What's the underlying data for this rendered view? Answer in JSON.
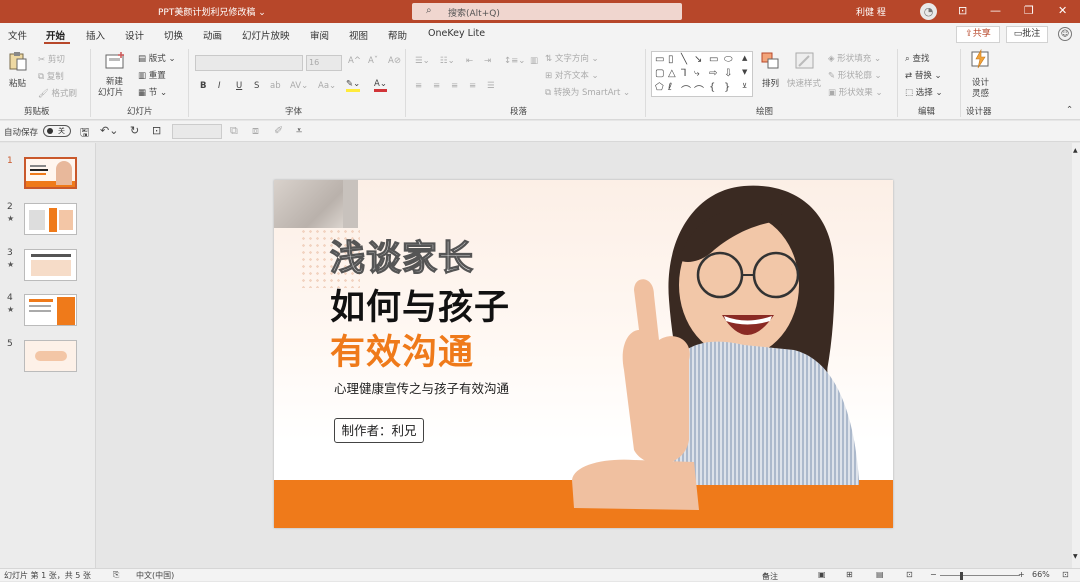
{
  "titlebar": {
    "doc_title": "PPT美颜计划利兄修改稿 ⌄",
    "search_placeholder": "搜索(Alt+Q)",
    "user": "利健 程",
    "minimize": "—",
    "restore": "❐",
    "close": "✕",
    "ribbon_options": "⊡"
  },
  "menu": {
    "tabs": [
      "文件",
      "开始",
      "插入",
      "设计",
      "切换",
      "动画",
      "幻灯片放映",
      "审阅",
      "视图",
      "帮助",
      "OneKey Lite"
    ],
    "active": "开始",
    "share": "共享",
    "comment": "批注"
  },
  "ribbon": {
    "clipboard": {
      "paste": "粘贴",
      "cut": "剪切",
      "copy": "复制",
      "format_painter": "格式刷",
      "group": "剪贴板"
    },
    "slides": {
      "new_slide_1": "新建",
      "new_slide_2": "幻灯片",
      "layout": "版式",
      "reset": "重置",
      "section": "节",
      "group": "幻灯片"
    },
    "font": {
      "size": "16",
      "group": "字体",
      "bold": "B",
      "italic": "I",
      "underline": "U",
      "strike": "S",
      "shadow": "ab"
    },
    "paragraph": {
      "text_direction": "文字方向",
      "align_text": "对齐文本",
      "smartart": "转换为 SmartArt",
      "group": "段落"
    },
    "drawing": {
      "arrange": "排列",
      "quick_styles": "快速样式",
      "shape_fill": "形状填充",
      "shape_outline": "形状轮廓",
      "shape_effects": "形状效果",
      "group": "绘图"
    },
    "editing": {
      "find": "查找",
      "replace": "替换",
      "select": "选择",
      "group": "编辑"
    },
    "designer": {
      "ideas_1": "设计",
      "ideas_2": "灵感",
      "group": "设计器"
    }
  },
  "qat": {
    "autosave": "自动保存",
    "toggle": "关"
  },
  "thumbnails": [
    {
      "num": "1",
      "star": ""
    },
    {
      "num": "2",
      "star": "★"
    },
    {
      "num": "3",
      "star": "★"
    },
    {
      "num": "4",
      "star": "★"
    },
    {
      "num": "5",
      "star": ""
    }
  ],
  "slide": {
    "line1": "浅谈家长",
    "line2": "如何与孩子",
    "line3": "有效沟通",
    "subtitle": "心理健康宣传之与孩子有效沟通",
    "author": "制作者：利兄"
  },
  "status": {
    "slide_info": "幻灯片 第 1 张，共 5 张",
    "lang": "中文(中国)",
    "notes": "备注",
    "zoom": "66%"
  },
  "colors": {
    "accent": "#b7472a",
    "orange": "#ef7a1a"
  }
}
